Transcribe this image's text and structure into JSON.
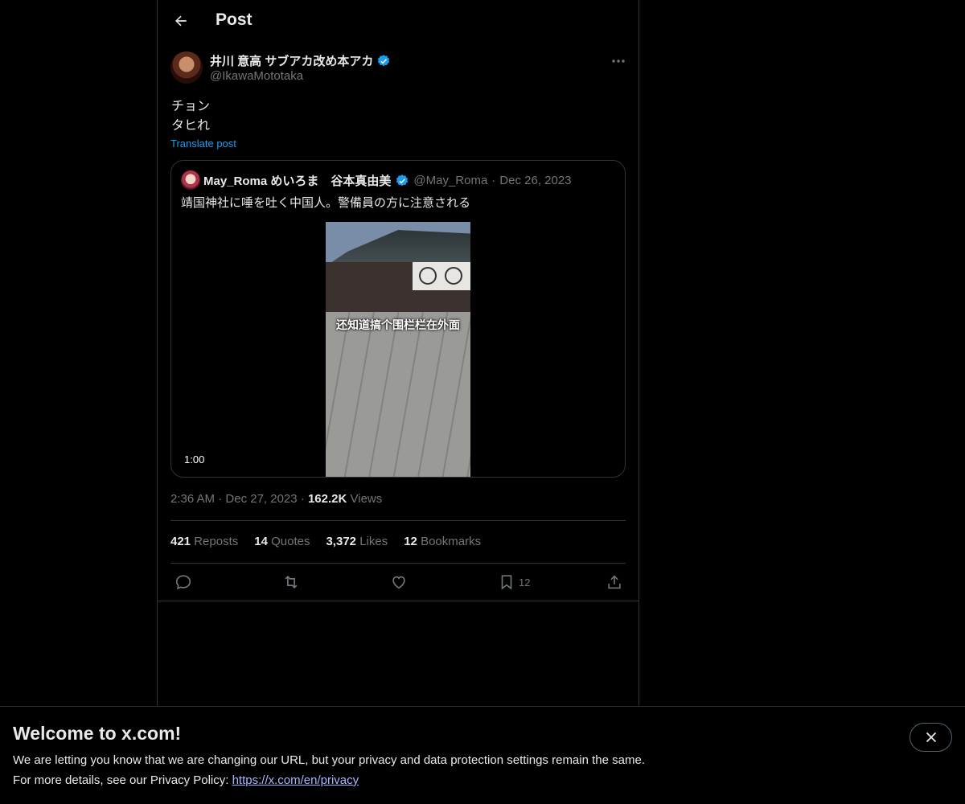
{
  "header": {
    "title": "Post"
  },
  "post": {
    "author_name": "井川 意高 サブアカ改め本アカ",
    "author_handle": "@IkawaMototaka",
    "text_lines": [
      "チョン",
      "タヒれ"
    ],
    "translate_label": "Translate post",
    "time": "2:36 AM",
    "date": "Dec 27, 2023",
    "views_count": "162.2K",
    "views_label": "Views",
    "separator": "·"
  },
  "quote": {
    "name": "May_Roma めいろま　谷本真由美",
    "handle": "@May_Roma",
    "separator": "·",
    "date": "Dec 26, 2023",
    "text": "靖国神社に唾を吐く中国人。警備員の方に注意される",
    "video_caption": "还知道搞个围栏栏在外面",
    "duration": "1:00"
  },
  "stats": {
    "reposts_count": "421",
    "reposts_label": "Reposts",
    "quotes_count": "14",
    "quotes_label": "Quotes",
    "likes_count": "3,372",
    "likes_label": "Likes",
    "bookmarks_count": "12",
    "bookmarks_label": "Bookmarks"
  },
  "actions": {
    "bookmark_count": "12"
  },
  "banner": {
    "title": "Welcome to x.com!",
    "line1": "We are letting you know that we are changing our URL, but your privacy and data protection settings remain the same.",
    "line2_prefix": "For more details, see our Privacy Policy: ",
    "link_text": "https://x.com/en/privacy"
  },
  "colors": {
    "accent": "#1d9bf0",
    "verified": "#1d9bf0",
    "muted": "#71767b",
    "border": "#2f3336",
    "link": "#a9b5ff"
  },
  "icons": [
    "back-arrow-icon",
    "verified-badge-icon",
    "more-icon",
    "reply-icon",
    "repost-icon",
    "like-icon",
    "bookmark-icon",
    "share-icon",
    "close-icon"
  ]
}
